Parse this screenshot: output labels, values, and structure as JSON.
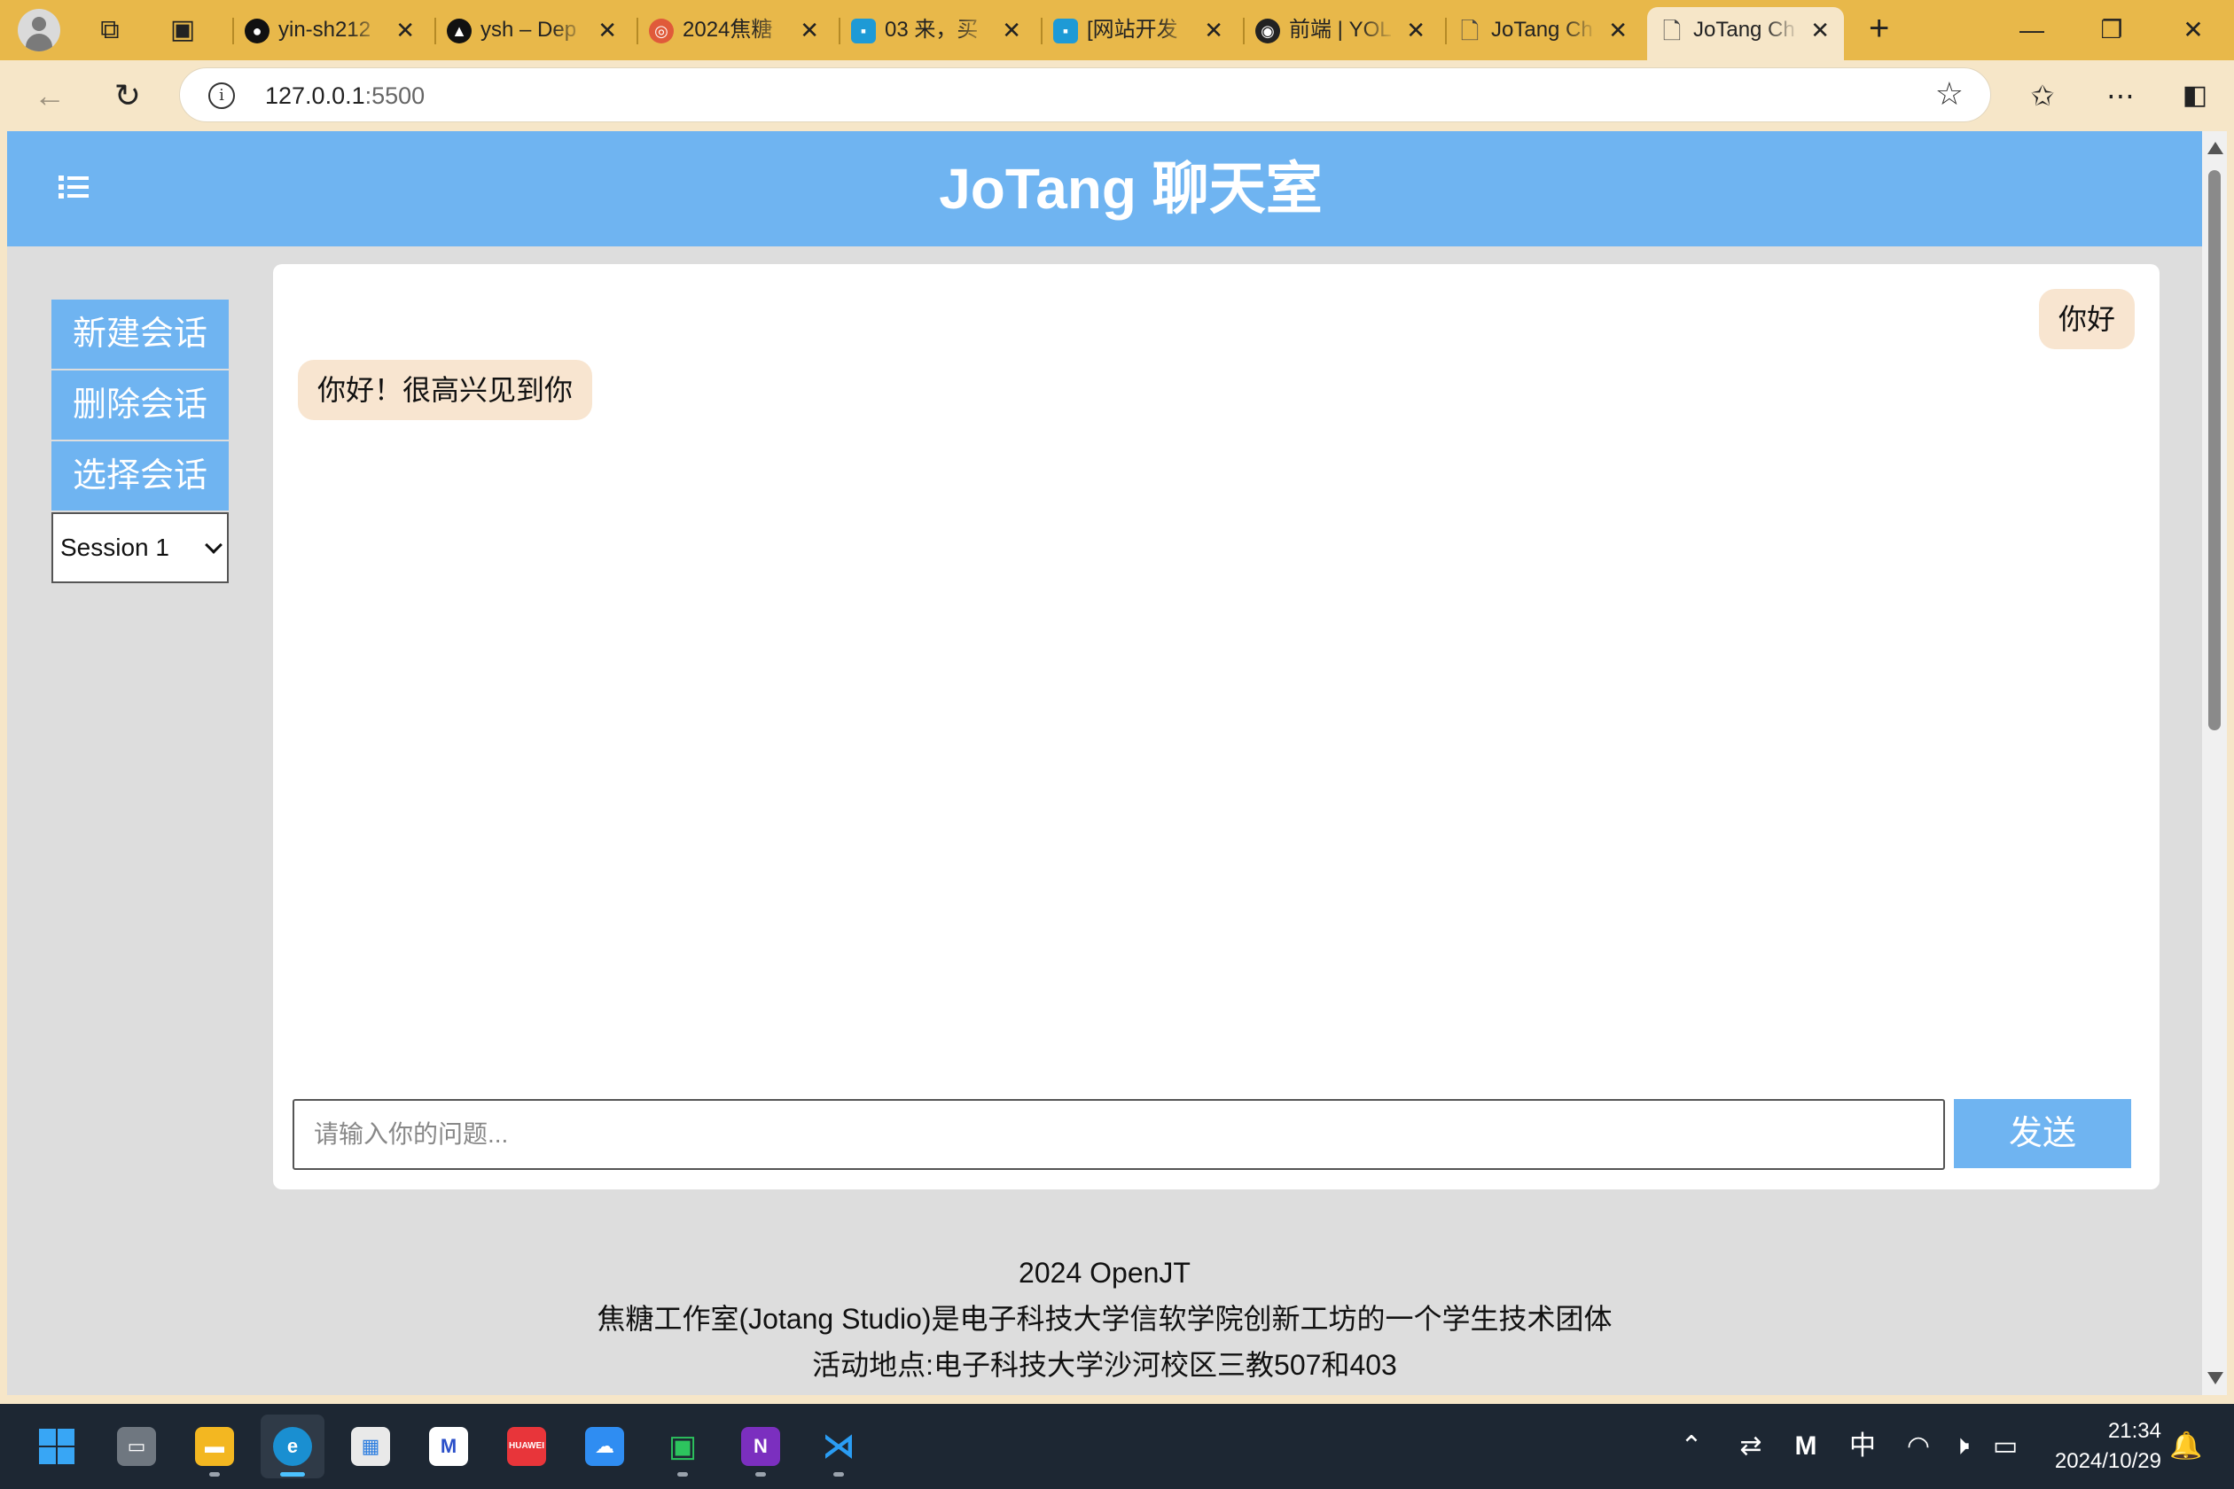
{
  "browser": {
    "tabs": [
      {
        "label": "yin-sh212",
        "favicon": "github-icon",
        "color": "#111111"
      },
      {
        "label": "ysh – Dep",
        "favicon": "vercel-icon",
        "color": "#111111"
      },
      {
        "label": "2024焦糖",
        "favicon": "spiral-icon",
        "color": "#e05a3a"
      },
      {
        "label": "03 来，买",
        "favicon": "bilibili-icon",
        "color": "#1e9ad6"
      },
      {
        "label": "[网站开发",
        "favicon": "bilibili-icon",
        "color": "#1e9ad6"
      },
      {
        "label": "前端 | YOL",
        "favicon": "owl-icon",
        "color": "#222222"
      },
      {
        "label": "JoTang Ch",
        "favicon": "page-icon",
        "color": "#444444"
      },
      {
        "label": "JoTang Ch",
        "favicon": "page-icon",
        "color": "#444444"
      }
    ],
    "active_tab_index": 7,
    "address": {
      "host": "127.0.0.1",
      "port": ":5500"
    }
  },
  "page": {
    "title": "JoTang 聊天室",
    "sidebar": {
      "new_session": "新建会话",
      "delete_session": "删除会话",
      "select_session": "选择会话",
      "session_selected": "Session 1"
    },
    "messages": [
      {
        "role": "user",
        "text": "你好"
      },
      {
        "role": "bot",
        "text": "你好！很高兴见到你"
      }
    ],
    "input": {
      "placeholder": "请输入你的问题..."
    },
    "send_label": "发送",
    "footer": [
      "2024 OpenJT",
      "焦糖工作室(Jotang Studio)是电子科技大学信软学院创新工坊的一个学生技术团体",
      "活动地点:电子科技大学沙河校区三教507和403"
    ],
    "colors": {
      "accent": "#6fb4f1",
      "bubble": "#f8e5d0",
      "background": "#dddddd"
    }
  },
  "taskbar": {
    "ime": "中",
    "time": "21:34",
    "date": "2024/10/29"
  }
}
